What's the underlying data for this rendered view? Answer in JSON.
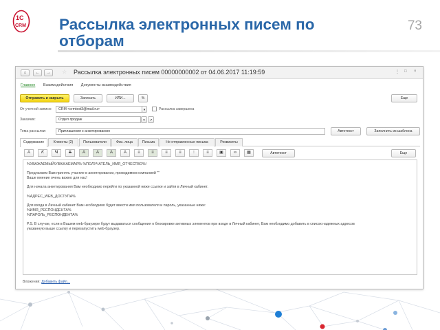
{
  "slide": {
    "title": "Рассылка электронных писем по отборам",
    "page_number": "73",
    "logo_text": "CRM",
    "colors": {
      "title": "#2a67a8",
      "logo_red": "#c8102e",
      "primary_button": "#f5d926"
    }
  },
  "window": {
    "title": "Рассылка электронных писем 00000000002 от 04.06.2017 11:19:59",
    "nav_icons": [
      "home-icon",
      "back-icon",
      "forward-icon"
    ],
    "ctrl_labels": [
      "⋮",
      "□",
      "×"
    ],
    "nav_links": [
      "Главное",
      "Взаимодействия",
      "Документы взаимодействия"
    ],
    "toolbar": {
      "send_close": "Отправить и закрыть",
      "save": "Записать",
      "or": "ИЛИ...",
      "more": "Еще"
    },
    "fields": {
      "account_label": "От учетной записи:",
      "account_value": "CRM <crmtest3@mail.ru>",
      "done_label": "Рассылка завершена",
      "order_label": "Заказчик:",
      "order_value": "Отдел продаж",
      "subject_label": "Тема рассылки:",
      "subject_value": "Приглашения к анкетированию",
      "autotext_btn": "Автотекст",
      "template_btn": "Заполнить из шаблона"
    },
    "tabs": [
      "Содержание",
      "Клиенты (2)",
      "Пользователи",
      "Физ. лица",
      "Письма",
      "Не отправленные письма",
      "Реквизиты"
    ],
    "format_buttons": [
      "A",
      "K",
      "Ч",
      "S",
      "A",
      "A",
      "A",
      "A",
      "≡",
      "≡",
      "≡",
      "≡",
      "⁝",
      "≡"
    ],
    "format_autotext": "Автотекст",
    "format_more": "Еще",
    "body_lines": [
      "%УВАЖАЕМЫЙ\\УВАЖАЕМАЯ% %ПОЛУЧАТЕЛЬ_ИМЯ_ОТЧЕСТВО%!",
      "Предлагаем Вам принять участие в анкетировании, проводимом компанией \"\"",
      "Ваше мнение очень важно для нас!",
      "Для начала анкетирования Вам необходимо перейти по указанной ниже ссылке и зайти в Личный кабинет.",
      "%АДРЕС_WEB_ДОСТУПА%",
      "Для входа в Личный кабинет Вам необходимо будет ввести имя пользователя и пароль, указанные ниже:",
      "%ИМЯ_РЕСПОНДЕНТА%",
      "%ПАРОЛЬ_РЕСПОНДЕНТА%",
      "P.S. В случае, если в Вашем web-браузере будут выдаваться сообщения о блокировке активных элементов при входе в Личный кабинет, Вам необходимо добавить в список надежных адресов",
      "указанную выше ссылку и перезапустить web-браузер."
    ],
    "attachments_label": "Вложения:",
    "attachments_link": "Добавить файл..."
  }
}
